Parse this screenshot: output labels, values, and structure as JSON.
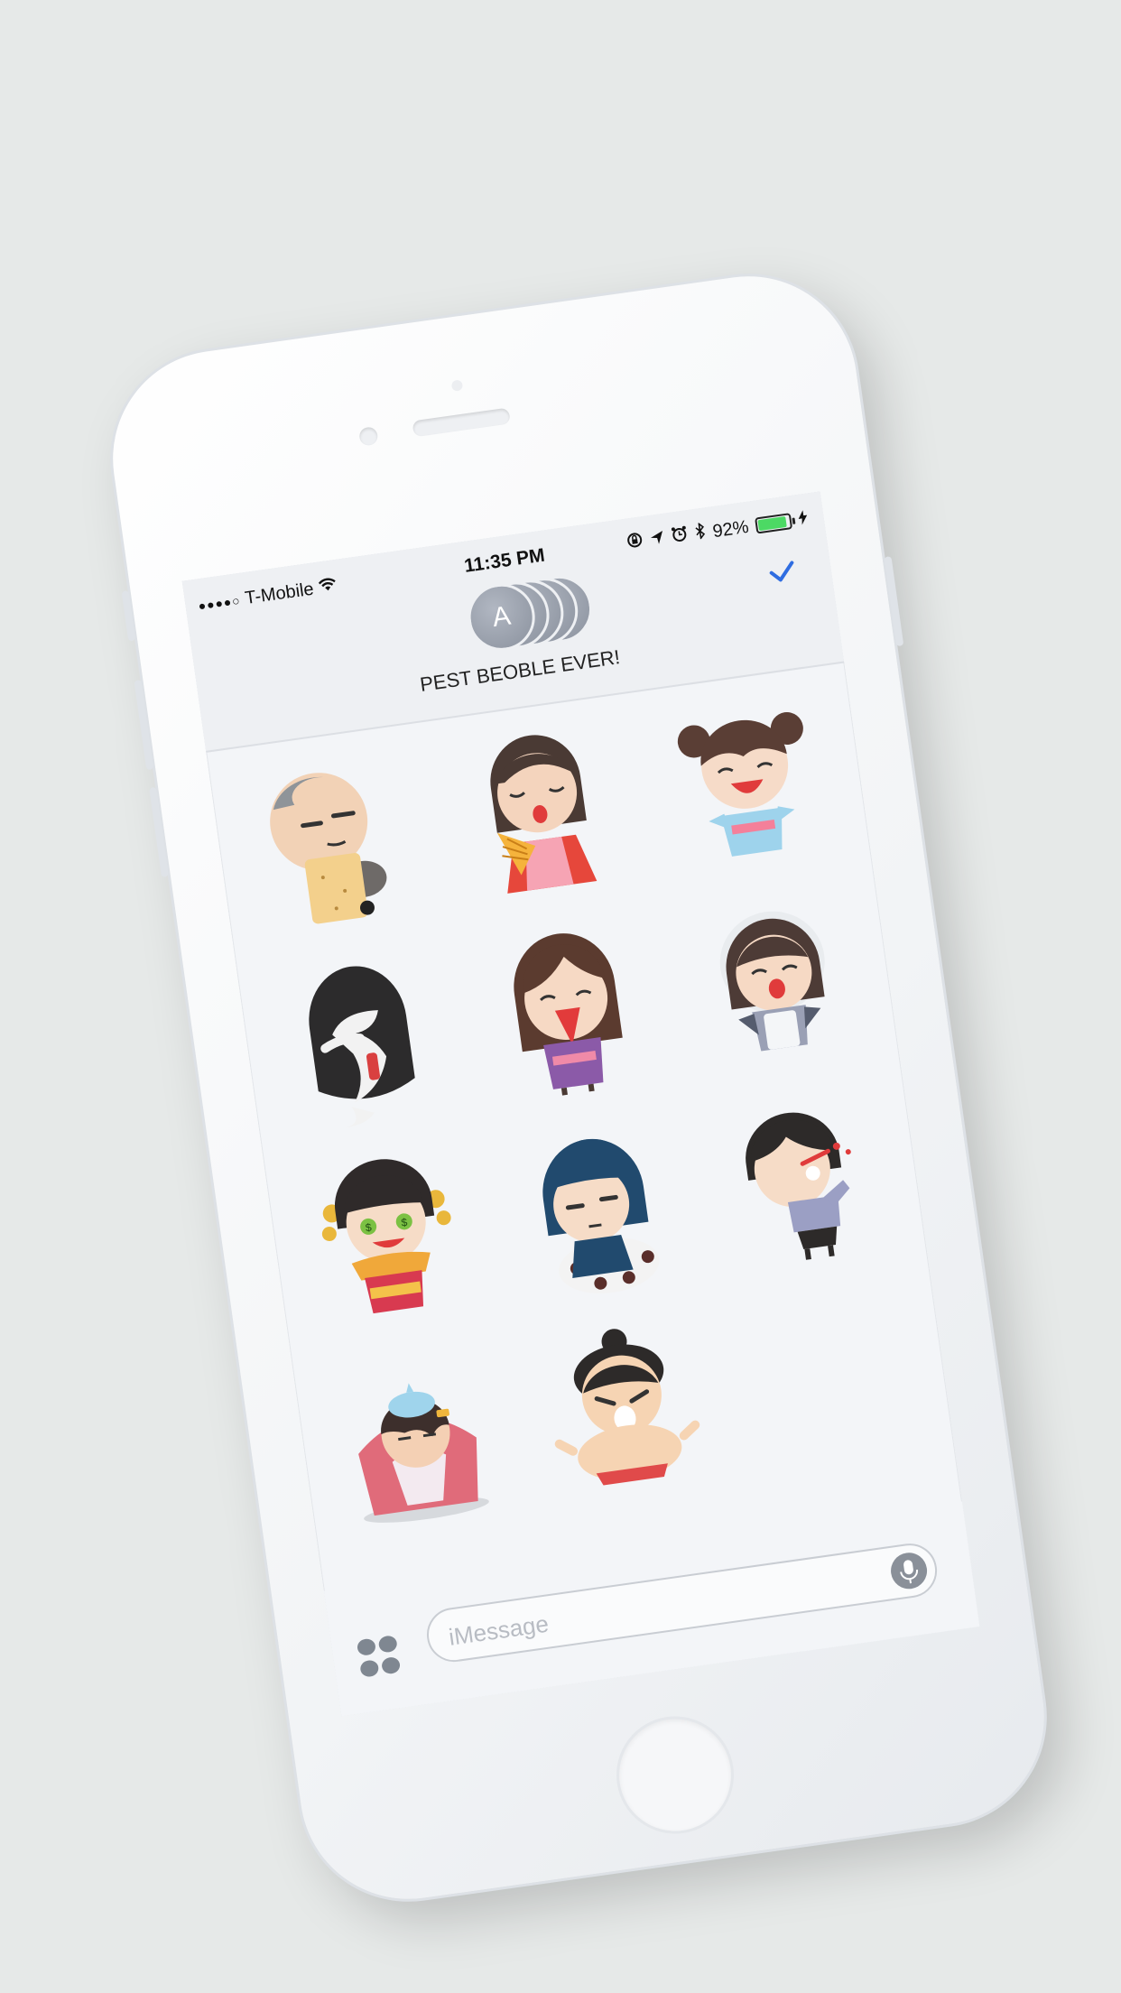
{
  "status_bar": {
    "signal": "●●●●○",
    "carrier": "T-Mobile",
    "time": "11:35 PM",
    "battery": "92%",
    "battery_level": 0.92
  },
  "conversation": {
    "avatar_initial": "A",
    "group_name": "PEST BEOBLE EVER!"
  },
  "stickers": [
    {
      "name": "old-man-scroll-sticker"
    },
    {
      "name": "girl-with-fan-sticker"
    },
    {
      "name": "girl-buns-laughing-sticker"
    },
    {
      "name": "ghost-sticker"
    },
    {
      "name": "girl-purple-kimono-sticker"
    },
    {
      "name": "maid-crying-sticker"
    },
    {
      "name": "geisha-money-eyes-sticker"
    },
    {
      "name": "ninja-sticker"
    },
    {
      "name": "boy-nosebleed-sticker"
    },
    {
      "name": "sick-ice-pack-sticker"
    },
    {
      "name": "sumo-sticker"
    }
  ],
  "input": {
    "placeholder": "iMessage"
  },
  "colors": {
    "accent": "#2f6de1",
    "battery": "#4cd964",
    "background": "#e6e9e8"
  }
}
